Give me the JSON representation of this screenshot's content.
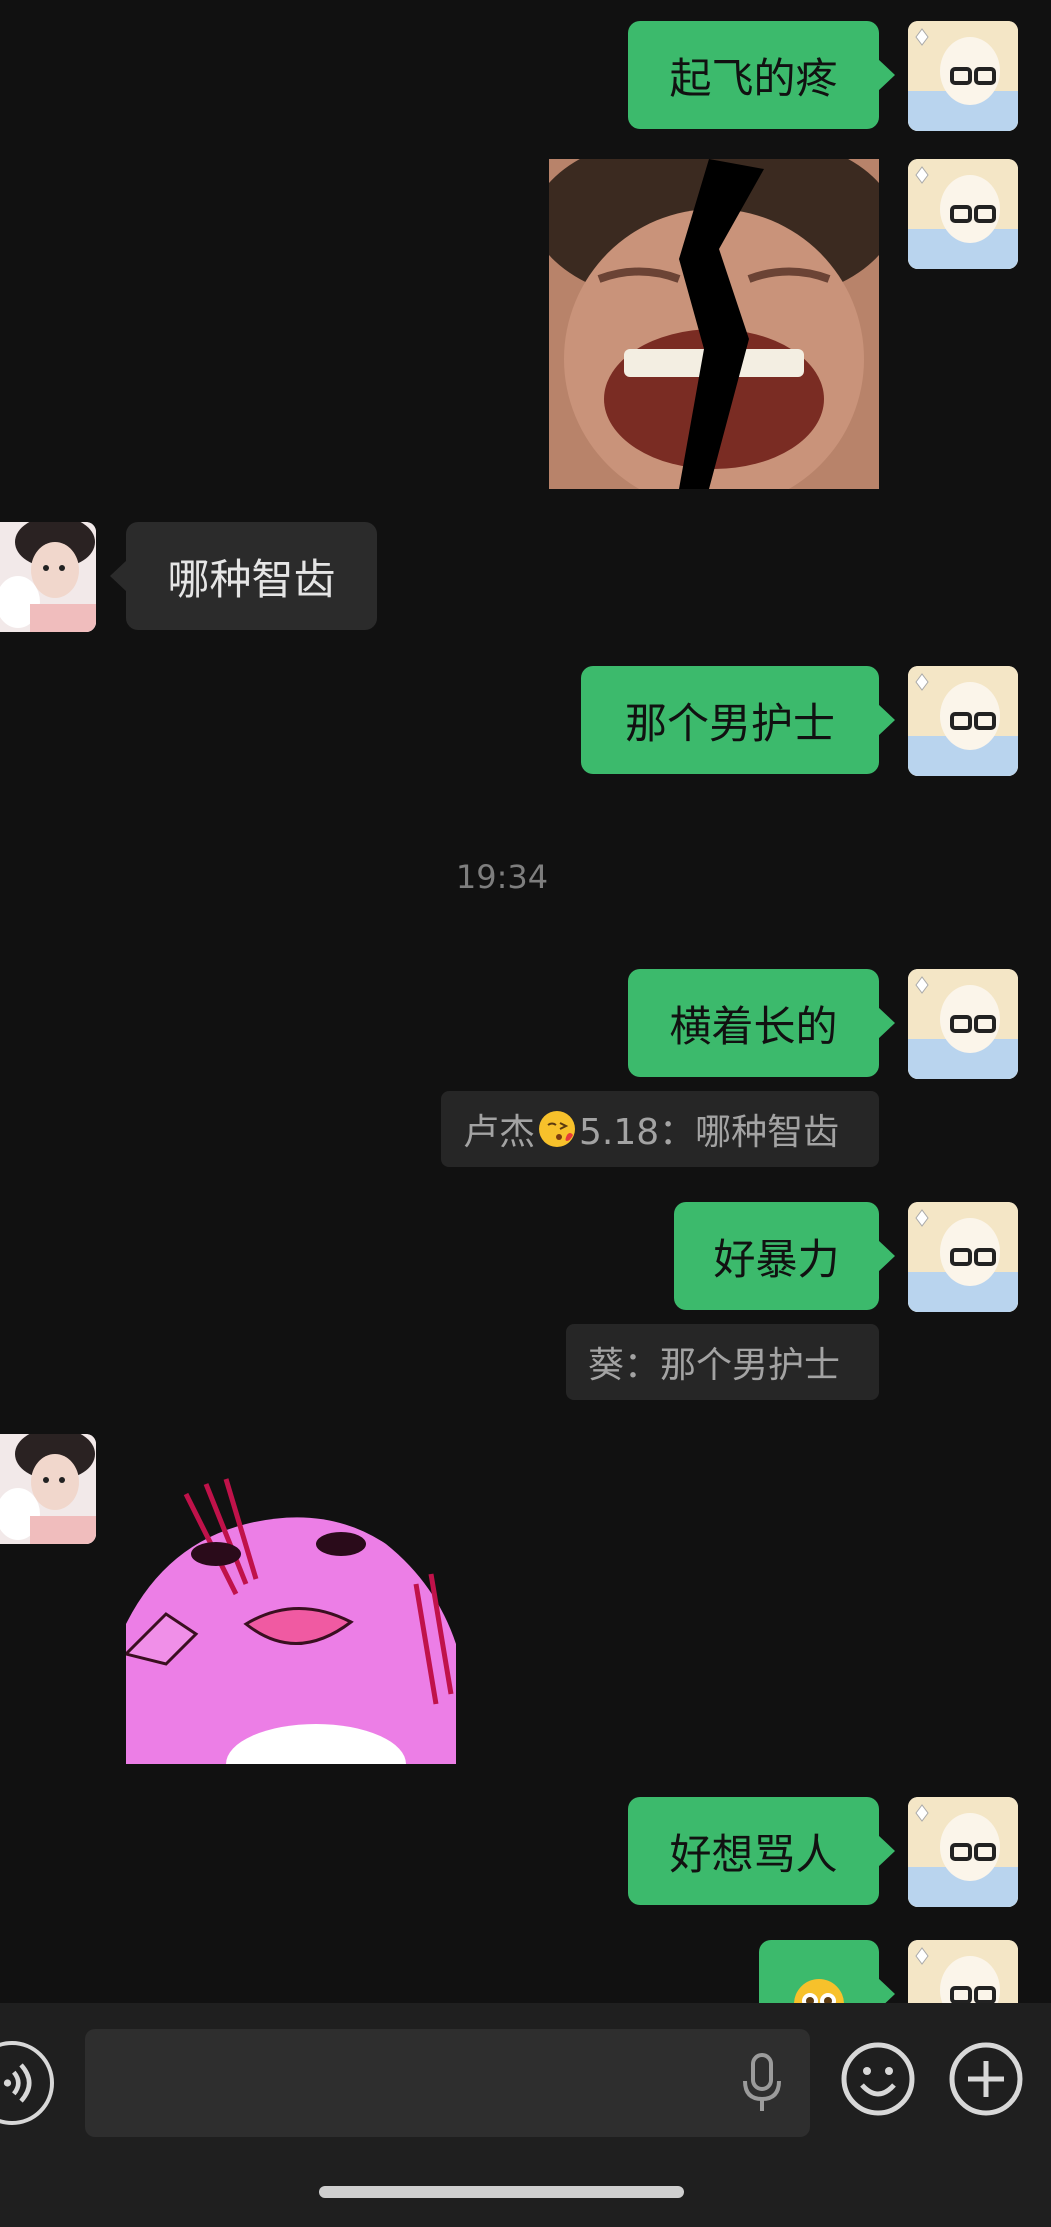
{
  "messages": [
    {
      "side": "me",
      "text": "起飞的疼"
    },
    {
      "side": "me",
      "type": "image",
      "desc": "laughing-face-photo"
    },
    {
      "side": "other",
      "text": "哪种智齿"
    },
    {
      "side": "me",
      "text": "那个男护士"
    },
    {
      "timestamp": "19:34"
    },
    {
      "side": "me",
      "text": "横着长的",
      "quote": {
        "prefix": "卢杰",
        "emoji": "kissing-face-emoji",
        "suffix": "5.18：哪种智齿"
      }
    },
    {
      "side": "me",
      "text": "好暴力",
      "quote": {
        "text": "葵：那个男护士"
      }
    },
    {
      "side": "other",
      "type": "sticker",
      "desc": "pink-creature-sticker"
    },
    {
      "side": "me",
      "text": "好想骂人"
    },
    {
      "side": "me",
      "type": "emoji",
      "desc": "flushed-face-emoji"
    }
  ],
  "input": {
    "placeholder": "",
    "value": ""
  },
  "colors": {
    "background": "#111111",
    "bubble_me": "#3cba6c",
    "bubble_other": "#2b2b2b",
    "input_bar": "#1f1f1f"
  }
}
